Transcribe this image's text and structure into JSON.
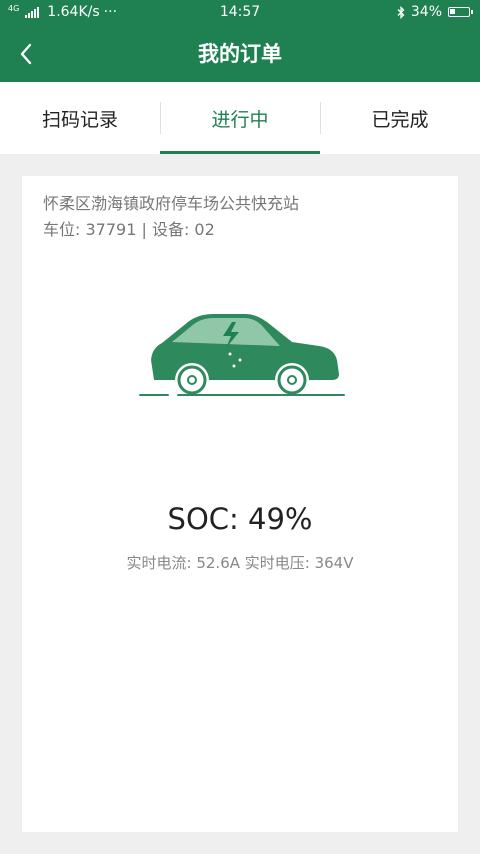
{
  "status_bar": {
    "network": "4G",
    "speed": "1.64K/s",
    "extra": "···",
    "time": "14:57",
    "battery": "34%",
    "battery_level": 0.34
  },
  "header": {
    "title": "我的订单"
  },
  "tabs": [
    {
      "label": "扫码记录",
      "active": false
    },
    {
      "label": "进行中",
      "active": true
    },
    {
      "label": "已完成",
      "active": false
    }
  ],
  "order": {
    "station": "怀柔区渤海镇政府停车场公共快充站",
    "spot": "车位: 37791 | 设备: 02",
    "soc": "SOC: 49%",
    "metrics": "实时电流: 52.6A 实时电压: 364V"
  },
  "colors": {
    "brand": "#1f8052",
    "background": "#efefef"
  }
}
